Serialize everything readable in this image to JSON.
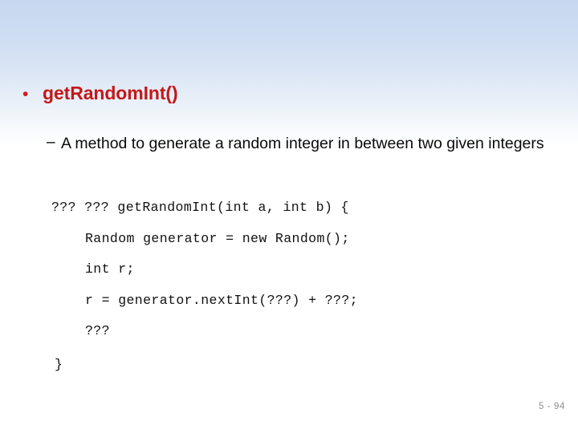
{
  "slide": {
    "background": {
      "gradient_top_color": "#c6d8f0",
      "gradient_bottom_color": "#ffffff"
    },
    "accent_color": "#c41818",
    "bullets": [
      {
        "level": 1,
        "marker": "•",
        "text": "getRandomInt()",
        "color": "#c41818"
      },
      {
        "level": 2,
        "marker": "–",
        "text": "A method to generate a random integer in between two given integers",
        "color": "#0a0a0a"
      }
    ],
    "code": {
      "lines": [
        {
          "indent": 0,
          "text": "??? ??? getRandomInt(int a, int b) {"
        },
        {
          "indent": 1,
          "text": "Random generator = new Random();"
        },
        {
          "indent": 1,
          "text": "int r;"
        },
        {
          "indent": 1,
          "text": "r = generator.nextInt(???) + ???;"
        },
        {
          "indent": 1,
          "text": "???"
        }
      ],
      "closing_brace": "}"
    },
    "footer": {
      "page_number": "5 - 94",
      "color": "#8f8f8f"
    }
  }
}
